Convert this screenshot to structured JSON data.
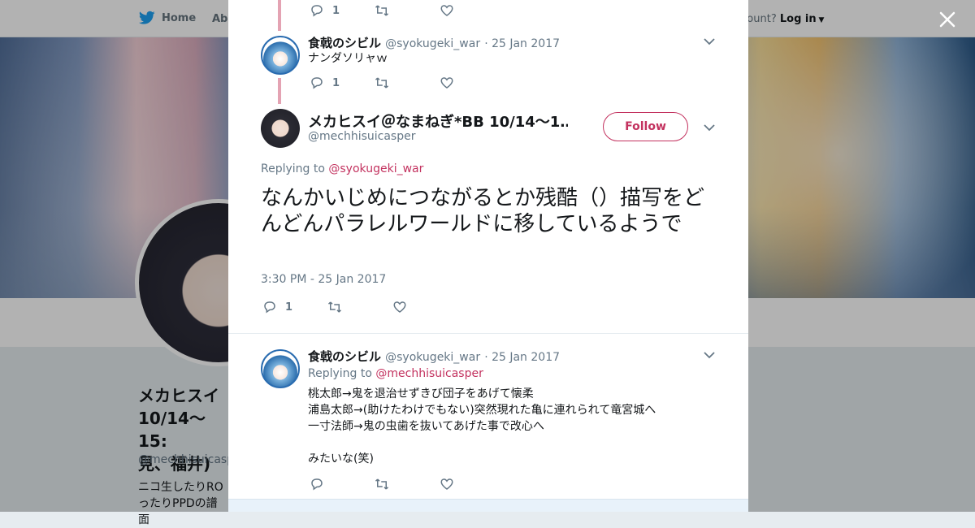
{
  "nav": {
    "home_label": "Home",
    "about_label": "Abo",
    "account_prompt": "ccount?",
    "login_label": "Log in"
  },
  "profile": {
    "name": "メカヒスイ\n10/14～15:\n見、福井)",
    "handle": "@mechhisuicasper",
    "bio": "ニコ生したりRO\nったりPPDの譜面"
  },
  "modal": {
    "tweets": [
      {
        "name": "食戟のシビル",
        "handle": "@syokugeki_war",
        "date": "· 25 Jan 2017",
        "text": "ナンダソリャｗ",
        "reply_count": "1"
      },
      {
        "name": "食戟のシビル",
        "handle": "@syokugeki_war",
        "date": "· 25 Jan 2017",
        "replying_prefix": "Replying to",
        "replying_handle": "@mechhisuicasper",
        "text": "桃太郎→鬼を退治せずきび団子をあげて懐柔\n浦島太郎→(助けたわけでもない)突然現れた亀に連れられて竜宮城へ\n一寸法師→鬼の虫歯を抜いてあげた事で改心へ\n\nみたいな(笑)"
      }
    ],
    "top_reply_count": "1",
    "main": {
      "name": "メカヒスイ＠なまねぎ*BB 10/14～1…",
      "handle": "@mechhisuicasper",
      "follow_label": "Follow",
      "replying_prefix": "Replying to",
      "replying_handle": "@syokugeki_war",
      "text": "なんかいじめにつながるとか残酷（）描写をどんどんパラレルワールドに移しているようで",
      "timestamp": "3:30 PM - 25 Jan 2017",
      "reply_count": "1"
    }
  },
  "colors": {
    "accent": "#c3325f",
    "thread_line": "#e4a3b3",
    "muted": "#657786"
  },
  "icons": [
    "twitter-bird-icon",
    "close-icon",
    "reply-icon",
    "retweet-icon",
    "like-icon",
    "chevron-down-icon"
  ]
}
